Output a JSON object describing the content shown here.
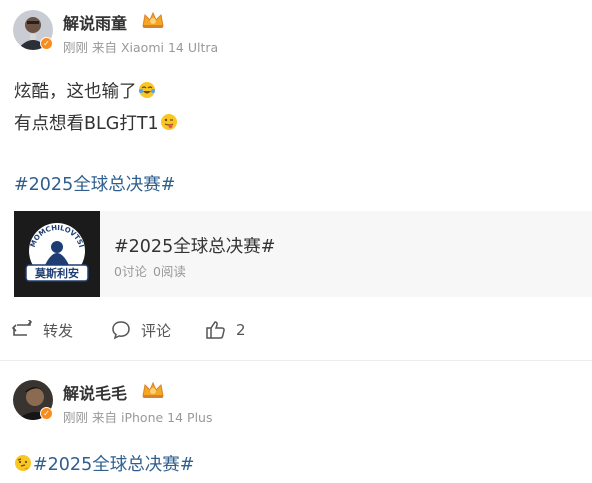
{
  "posts": [
    {
      "username": "解说雨童",
      "time": "刚刚",
      "source": "来自 Xiaomi 14 Ultra",
      "content_lines": [
        "炫酷，这也输了",
        "有点想看BLG打T1"
      ],
      "topic": "#2025全球总决赛#",
      "card": {
        "title": "#2025全球总决赛#",
        "discussions": "0讨论",
        "reads": "0阅读",
        "thumb_text": "MOMCHILOVTSI",
        "thumb_label": "莫斯利安"
      },
      "actions": {
        "repost": "转发",
        "comment": "评论",
        "like_count": "2"
      }
    },
    {
      "username": "解说毛毛",
      "time": "刚刚",
      "source": "来自 iPhone 14 Plus",
      "topic": "#2025全球总决赛#"
    }
  ],
  "icons": {
    "vip": "crown-vip-icon",
    "verified": "verified-badge-icon",
    "repost": "repost-icon",
    "comment": "comment-icon",
    "like": "thumbs-up-icon",
    "emoji1": "laugh-cry-emoji",
    "emoji2": "tongue-emoji",
    "emoji3": "thinking-emoji"
  },
  "colors": {
    "topic_link": "#2f5f8e",
    "meta_text": "#999999",
    "badge_orange": "#f78d1e",
    "card_bg": "#f7f7f7"
  }
}
